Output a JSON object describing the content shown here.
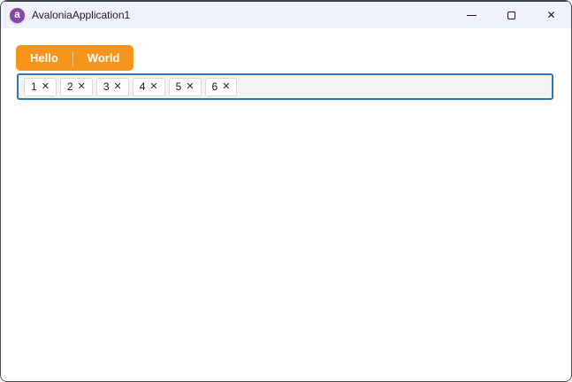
{
  "window": {
    "title": "AvaloniaApplication1",
    "logo_letter": "a",
    "controls": {
      "minimize": "minimize",
      "maximize": "maximize",
      "close": "close",
      "close_glyph": "✕"
    }
  },
  "colors": {
    "accent_orange": "#F7941E",
    "focus_border_blue": "#2B77B4",
    "titlebar_bg": "#EFF3F9",
    "logo_purple": "#8B46A4",
    "content_bg": "#FFFFFF",
    "tagbox_bg": "#F2F3F5"
  },
  "tab_strip": {
    "items": [
      {
        "label": "Hello"
      },
      {
        "label": "World"
      }
    ]
  },
  "tag_box": {
    "chip_close_glyph": "✕",
    "chips": [
      {
        "label": "1"
      },
      {
        "label": "2"
      },
      {
        "label": "3"
      },
      {
        "label": "4"
      },
      {
        "label": "5"
      },
      {
        "label": "6"
      }
    ]
  }
}
